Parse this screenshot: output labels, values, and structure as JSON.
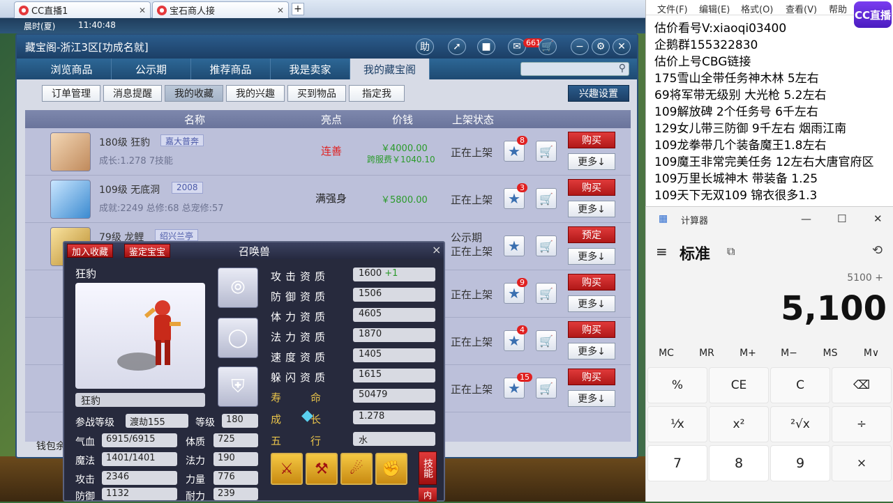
{
  "browser": {
    "tabs": [
      {
        "label": "CC直播1"
      },
      {
        "label": "宝石商人接"
      }
    ],
    "newtab": "+"
  },
  "game_top": {
    "left_text": "晨时(夏)",
    "time": "11:40:48"
  },
  "shop": {
    "title": "藏宝阁-浙江3区[功成名就]",
    "title_buttons": {
      "help": "助",
      "notifications": "661"
    },
    "nav_tabs": [
      "浏览商品",
      "公示期",
      "推荐商品",
      "我是卖家",
      "我的藏宝阁"
    ],
    "active_nav": "我的藏宝阁",
    "sub_tabs": [
      "订单管理",
      "消息提醒",
      "我的收藏",
      "我的兴趣",
      "买到物品",
      "指定我"
    ],
    "active_sub": "我的收藏",
    "interest_settings": "兴趣设置",
    "table_headers": {
      "name": "名称",
      "highlight": "亮点",
      "price": "价钱",
      "status": "上架状态"
    },
    "rows": [
      {
        "name": "180级 狂豹",
        "tag": "嘉大普奔",
        "desc": "成长:1.278 7技能",
        "highlight": "连善",
        "price": "￥4000.00",
        "fee": "跨服费￥1040.10",
        "status": "正在上架",
        "stars": "8",
        "action": "购买",
        "more": "更多↓"
      },
      {
        "name": "109级 无底洞",
        "tag": "2008",
        "desc": "成就:2249 总修:68 总宠修:57",
        "highlight": "满强身",
        "price": "￥5800.00",
        "fee": "",
        "status": "正在上架",
        "stars": "3",
        "action": "购买",
        "more": "更多↓"
      },
      {
        "name": "79级 龙鲤",
        "tag": "绍兴兰亭",
        "desc": "",
        "highlight": "",
        "price": "",
        "fee": "",
        "status": "公示期",
        "status2": "正在上架",
        "stars": "",
        "action": "预定",
        "more": "更多↓"
      },
      {
        "name": "",
        "tag": "",
        "desc": "",
        "highlight": "",
        "price": "",
        "fee": "",
        "status": "正在上架",
        "stars": "9",
        "action": "购买",
        "more": "更多↓"
      },
      {
        "name": "",
        "tag": "",
        "desc": "",
        "highlight": "",
        "price": "",
        "fee": "",
        "status": "正在上架",
        "stars": "4",
        "action": "购买",
        "more": "更多↓"
      },
      {
        "name": "",
        "tag": "",
        "desc": "",
        "highlight": "",
        "price": "",
        "fee": "",
        "status": "正在上架",
        "stars": "15",
        "action": "购买",
        "more": "更多↓"
      }
    ],
    "wallet": "钱包余"
  },
  "pet": {
    "add_fav": "加入收藏",
    "identify": "鉴定宝宝",
    "title": "召唤兽",
    "close": "×",
    "name": "狂豹",
    "name_box": "狂豹",
    "attributes": [
      {
        "label": "攻击资质",
        "value": "1600",
        "extra": "+1"
      },
      {
        "label": "防御资质",
        "value": "1506"
      },
      {
        "label": "体力资质",
        "value": "4605"
      },
      {
        "label": "法力资质",
        "value": "1870"
      },
      {
        "label": "速度资质",
        "value": "1405"
      },
      {
        "label": "躲闪资质",
        "value": "1615"
      },
      {
        "label": "寿命",
        "value": "50479"
      },
      {
        "label": "成长",
        "value": "1.278"
      },
      {
        "label": "五行",
        "value": "水"
      }
    ],
    "combat_level_label": "参战等级",
    "combat_level": "渡劫155",
    "level_label": "等级",
    "level": "180",
    "stats_left": [
      {
        "label": "气血",
        "value": "6915/6915"
      },
      {
        "label": "魔法",
        "value": "1401/1401"
      },
      {
        "label": "攻击",
        "value": "2346"
      },
      {
        "label": "防御",
        "value": "1132"
      }
    ],
    "stats_right": [
      {
        "label": "体质",
        "value": "725"
      },
      {
        "label": "法力",
        "value": "190"
      },
      {
        "label": "力量",
        "value": "776"
      },
      {
        "label": "耐力",
        "value": "239"
      }
    ],
    "skills_button": "技能",
    "inner_button": "内"
  },
  "notepad": {
    "menu": [
      "文件(F)",
      "编辑(E)",
      "格式(O)",
      "查看(V)",
      "帮助"
    ],
    "lines": [
      "估价看号V:xiaoqi03400",
      "企鹅群155322830",
      "估价上号CBG链接",
      "175雪山全带任务神木林 5左右",
      "69将军带无级别 大光枪 5.2左右",
      "109解放碑 2个任务号 6千左右",
      "129女儿带三防御 9千左右 烟雨江南",
      "109龙拳带几个装备魔王1.8左右",
      "109魔王非常完美任务 12左右大唐官府区",
      "109万里长城神木 带装备  1.25",
      "109天下无双109  锦衣很多1.3"
    ],
    "logo": "CC直播"
  },
  "calculator": {
    "title": "计算器",
    "mode": "标准",
    "expression": "5100 +",
    "display": "5,100",
    "memory": [
      "MC",
      "MR",
      "M+",
      "M−",
      "MS",
      "M∨"
    ],
    "keys": [
      [
        "%",
        "CE",
        "C",
        "⌫"
      ],
      [
        "¹⁄x",
        "x²",
        "²√x",
        "÷"
      ],
      [
        "7",
        "8",
        "9",
        "×"
      ]
    ]
  },
  "colors": {
    "shop_title": "#1c3f66",
    "buy_red": "#b01818",
    "price_green": "#2a9a2a"
  }
}
